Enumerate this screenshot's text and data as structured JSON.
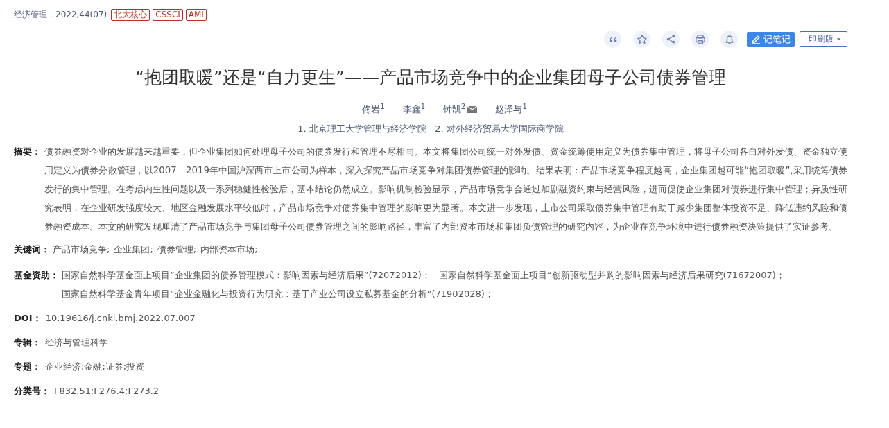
{
  "source": {
    "journal": "经济管理",
    "issue": "．2022,44(07)",
    "tags": [
      "北大核心",
      "CSSCI",
      "AMI"
    ]
  },
  "toolbar": {
    "icons": [
      {
        "kind": "quote"
      },
      {
        "kind": "star"
      },
      {
        "kind": "share"
      },
      {
        "kind": "print"
      },
      {
        "kind": "bell"
      }
    ],
    "note_button": "记笔记",
    "print_button": "印刷版"
  },
  "title": "“抱团取暖”还是“自力更生”——产品市场竞争中的企业集团母子公司债券管理",
  "authors": [
    {
      "name": "佟岩",
      "affiliation": "1",
      "email": false
    },
    {
      "name": "李鑫",
      "affiliation": "1",
      "email": false
    },
    {
      "name": "钟凯",
      "affiliation": "2",
      "email": true
    },
    {
      "name": "赵泽与",
      "affiliation": "1",
      "email": false
    }
  ],
  "affiliations": "1. 北京理工大学管理与经济学院   2. 对外经济贸易大学国际商学院",
  "abstract": {
    "label": "摘要：",
    "text": "债券融资对企业的发展越来越重要，但企业集团如何处理母子公司的债券发行和管理不尽相同。本文将集团公司统一对外发债、资金统筹使用定义为债券集中管理，将母子公司各自对外发债、资金独立使用定义为债券分散管理，以2007—2019年中国沪深两市上市公司为样本，深入探究产品市场竞争对集团债券管理的影响。结果表明：产品市场竞争程度越高，企业集团越可能“抱团取暖”,采用统筹债券发行的集中管理。在考虑内生性问题以及一系列稳健性检验后，基本结论仍然成立。影响机制检验显示，产品市场竞争会通过加剧融资约束与经营风险，进而促使企业集团对债券进行集中管理；异质性研究表明，在企业研发强度较大、地区金融发展水平较低时，产品市场竞争对债券集中管理的影响更为显著。本文进一步发现，上市公司采取债券集中管理有助于减少集团整体投资不足、降低违约风险和债券融资成本。本文的研究发现厘清了产品市场竞争与集团母子公司债券管理之间的影响路径，丰富了内部资本市场和集团负债管理的研究内容，为企业在竞争环境中进行债券融资决策提供了实证参考。"
  },
  "keywords": {
    "label": "关键词：",
    "items": [
      "产品市场竞争;",
      "企业集团;",
      "债券管理;",
      "内部资本市场;"
    ]
  },
  "funds": {
    "label": "基金资助：",
    "items": [
      "国家自然科学基金面上项目“企业集团的债券管理模式：影响因素与经济后果”(72072012)；",
      "国家自然科学基金面上项目“创新驱动型并购的影响因素与经济后果研究(71672007)；",
      "国家自然科学基金青年项目“企业金融化与投资行为研究：基于产业公司设立私募基金的分析”(71902028)；"
    ]
  },
  "fields": [
    {
      "label": "DOI：",
      "value": "10.19616/j.cnki.bmj.2022.07.007"
    },
    {
      "label": "专辑：",
      "value": "经济与管理科学"
    },
    {
      "label": "专题：",
      "value": "企业经济;金融;证券;投资"
    },
    {
      "label": "分类号：",
      "value": "F832.51;F276.4;F273.2"
    }
  ]
}
